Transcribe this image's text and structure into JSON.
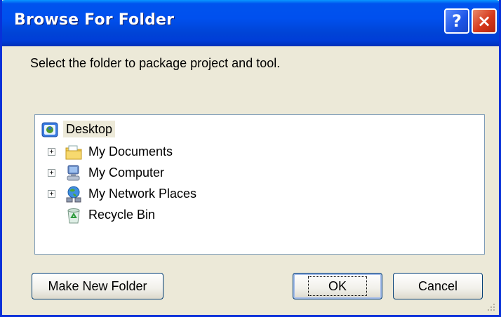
{
  "window": {
    "title": "Browse For Folder",
    "help_glyph": "?",
    "close_glyph": "×"
  },
  "dialog": {
    "prompt": "Select the folder to package project and tool."
  },
  "tree": {
    "items": [
      {
        "label": "Desktop",
        "icon": "desktop-icon",
        "expandable": false,
        "selected": true
      },
      {
        "label": "My Documents",
        "icon": "my-documents-icon",
        "expandable": true,
        "expander": "+"
      },
      {
        "label": "My Computer",
        "icon": "my-computer-icon",
        "expandable": true,
        "expander": "+"
      },
      {
        "label": "My Network Places",
        "icon": "network-places-icon",
        "expandable": true,
        "expander": "+"
      },
      {
        "label": "Recycle Bin",
        "icon": "recycle-bin-icon",
        "expandable": false
      }
    ]
  },
  "buttons": {
    "make_new_folder": "Make New Folder",
    "ok": "OK",
    "cancel": "Cancel"
  },
  "colors": {
    "titlebar": "#0050ee",
    "dialog_bg": "#ece9d8",
    "tree_border": "#7f9db9"
  }
}
